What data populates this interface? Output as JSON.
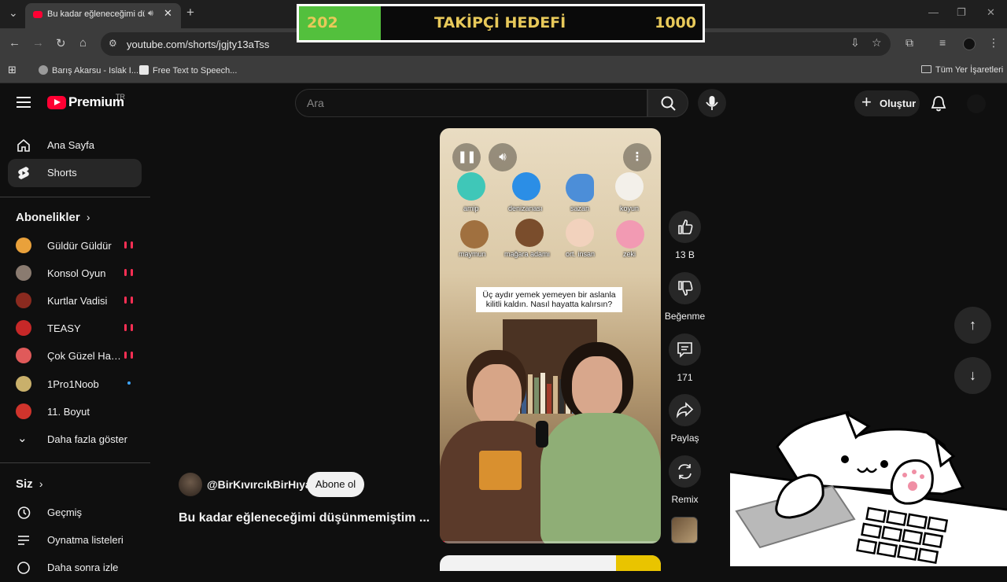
{
  "browser": {
    "tab_title": "Bu kadar eğleneceğimi düşü",
    "new_tab": "+",
    "url": "youtube.com/shorts/jgjty13aTss",
    "bookmarks": [
      {
        "label": "Barış Akarsu - Islak I..."
      },
      {
        "label": "Free Text to Speech..."
      }
    ],
    "all_bookmarks": "Tüm Yer İşaretleri"
  },
  "overlay_goal": {
    "current": "202",
    "label": "TAKİPÇİ HEDEFİ",
    "target": "1000",
    "progress_fraction": 0.202,
    "fill_color": "#53c03d",
    "text_color": "#e8c95a"
  },
  "youtube": {
    "logo_text": "Premium",
    "region": "TR",
    "search_placeholder": "Ara",
    "create_label": "Oluştur"
  },
  "sidebar": {
    "main": [
      {
        "label": "Ana Sayfa",
        "icon": "home-icon"
      },
      {
        "label": "Shorts",
        "icon": "shorts-icon",
        "active": true
      }
    ],
    "subscriptions_title": "Abonelikler",
    "subscriptions": [
      {
        "name": "Güldür Güldür",
        "status": "live",
        "color": "#e9a13b"
      },
      {
        "name": "Konsol Oyun",
        "status": "live",
        "color": "#8a7b70"
      },
      {
        "name": "Kurtlar Vadisi",
        "status": "live",
        "color": "#8a2a1f"
      },
      {
        "name": "TEASY",
        "status": "live",
        "color": "#c62828"
      },
      {
        "name": "Çok Güzel Hareketler Bunlar",
        "status": "live",
        "color": "#e05a5a"
      },
      {
        "name": "1Pro1Noob",
        "status": "new",
        "color": "#c9b06b"
      },
      {
        "name": "11. Boyut",
        "status": "none",
        "color": "#d0342c"
      }
    ],
    "show_more": "Daha fazla göster",
    "you_title": "Siz",
    "you_items": [
      {
        "label": "Geçmiş",
        "icon": "history-icon"
      },
      {
        "label": "Oynatma listeleri",
        "icon": "playlists-icon"
      },
      {
        "label": "Daha sonra izle",
        "icon": "watch-later-icon"
      }
    ]
  },
  "short": {
    "caption": "Üç aydır yemek yemeyen bir aslanla kilitli kaldın. Nasıl hayatta kalırsın?",
    "emoji_labels": [
      "amip",
      "denizanası",
      "sazan",
      "koyun",
      "maymun",
      "mağara adamı",
      "ort. insan",
      "zeki"
    ],
    "channel": "@BirKıvırcıkBirHıyar",
    "subscribe": "Abone ol",
    "title": "Bu kadar eğleneceğimi düşünmemiştim ...",
    "progress_fraction": 0.02
  },
  "actions": {
    "likes": "13 B",
    "dislike": "Beğenme",
    "comments": "171",
    "share": "Paylaş",
    "remix": "Remix"
  },
  "colors": {
    "youtube_red": "#ff0033",
    "page_bg": "#0f0f0f",
    "chip_bg": "#272727"
  }
}
